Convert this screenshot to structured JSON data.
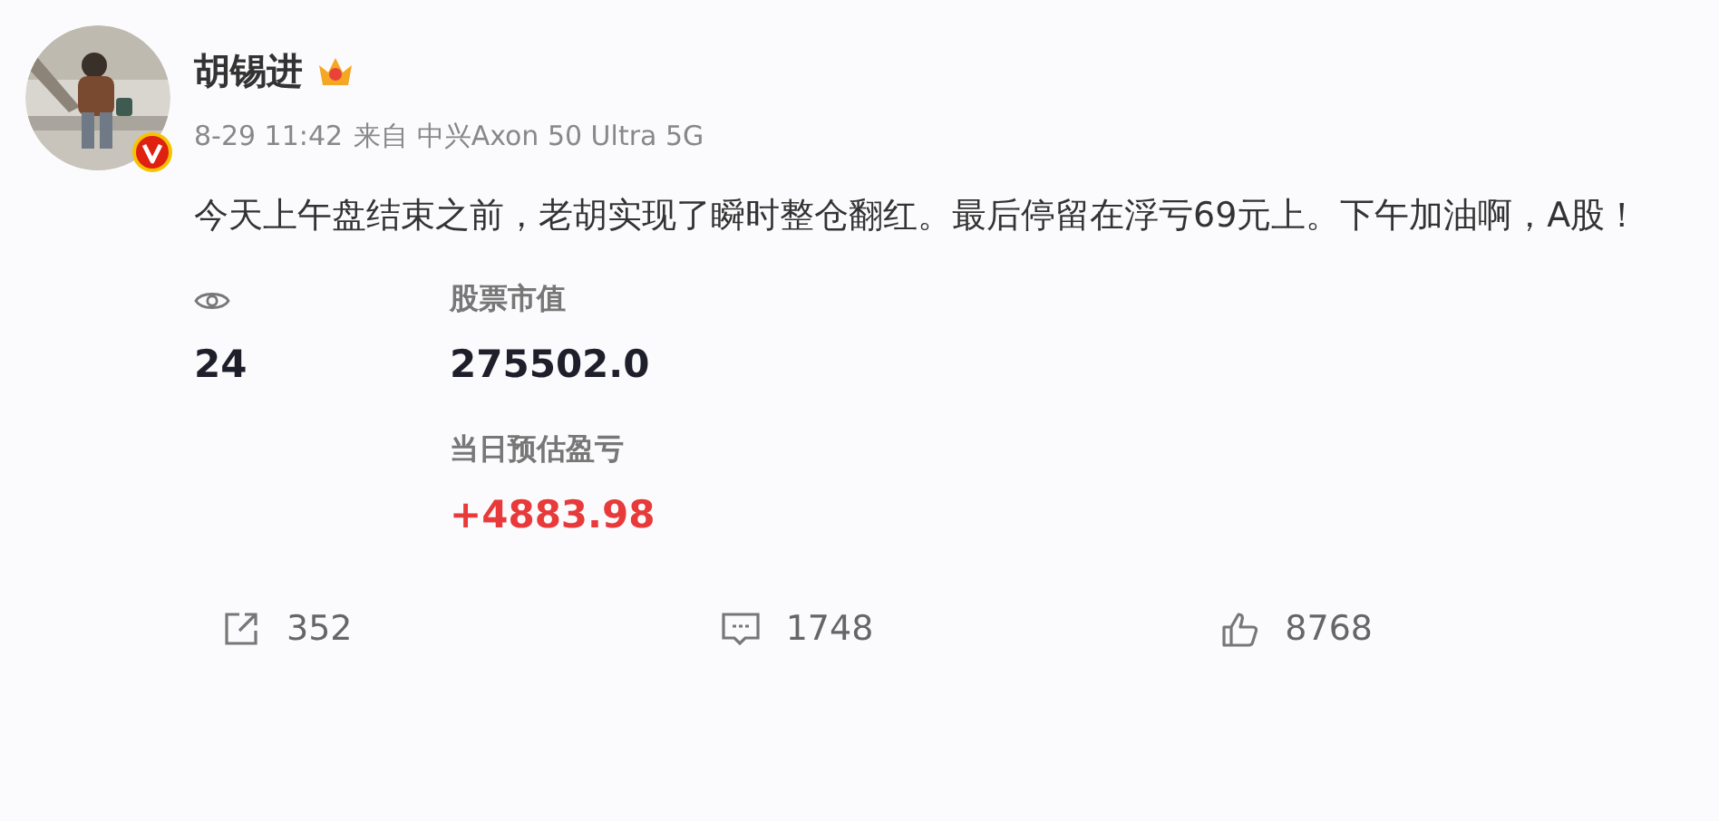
{
  "author": {
    "name": "胡锡进",
    "verified": true
  },
  "meta": {
    "time": "8-29 11:42",
    "source": "来自 中兴Axon 50 Ultra 5G"
  },
  "text": "今天上午盘结束之前，老胡实现了瞬时整仓翻红。最后停留在浮亏69元上。下午加油啊，A股！",
  "stats": {
    "views": "24",
    "market_value_label": "股票市值",
    "market_value": "275502.0",
    "pnl_label": "当日预估盈亏",
    "pnl": "+4883.98"
  },
  "actions": [
    {
      "kind": "share",
      "count": "352"
    },
    {
      "kind": "comment",
      "count": "1748"
    },
    {
      "kind": "like",
      "count": "8768"
    }
  ]
}
